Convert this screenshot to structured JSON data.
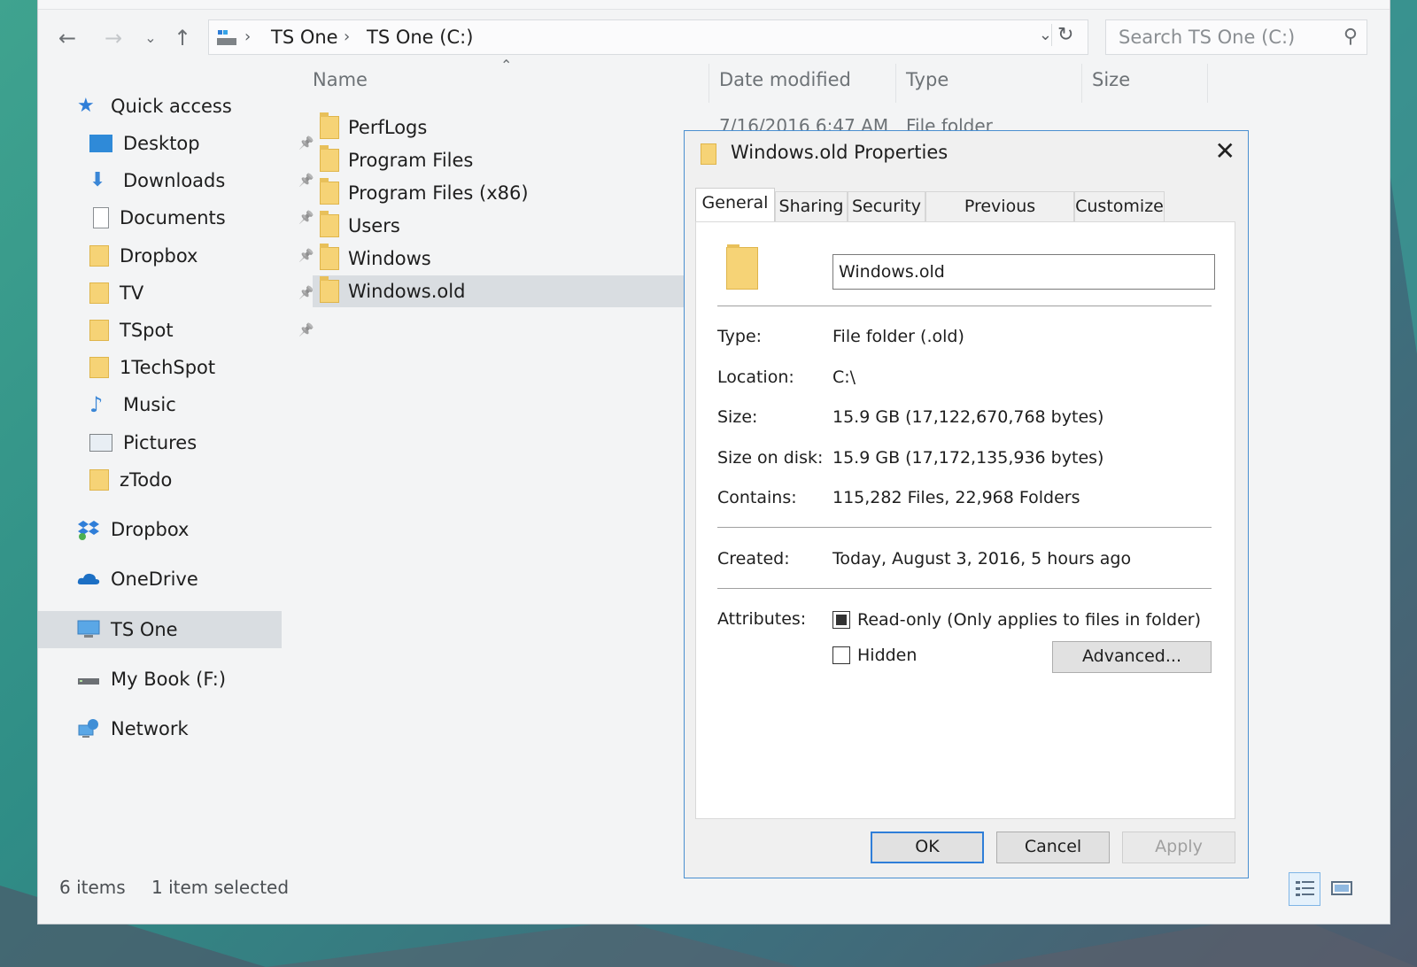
{
  "address": {
    "crumbs": [
      "TS One",
      "TS One (C:)"
    ],
    "search_placeholder": "Search TS One (C:)"
  },
  "columns": {
    "name": "Name",
    "date": "Date modified",
    "type": "Type",
    "size": "Size",
    "partial_date": "7/16/2016 6:47 AM",
    "partial_type": "File folder"
  },
  "nav": {
    "quick_access": "Quick access",
    "items": [
      {
        "label": "Desktop",
        "icon": "desktop-icon",
        "pinned": true
      },
      {
        "label": "Downloads",
        "icon": "downloads-icon",
        "pinned": true
      },
      {
        "label": "Documents",
        "icon": "documents-icon",
        "pinned": true
      },
      {
        "label": "Dropbox",
        "icon": "folder-icon",
        "pinned": true
      },
      {
        "label": "TV",
        "icon": "folder-icon",
        "pinned": true
      },
      {
        "label": "TSpot",
        "icon": "folder-icon",
        "pinned": true
      },
      {
        "label": "1TechSpot",
        "icon": "folder-icon",
        "pinned": false
      },
      {
        "label": "Music",
        "icon": "music-icon",
        "pinned": false
      },
      {
        "label": "Pictures",
        "icon": "pictures-icon",
        "pinned": false
      },
      {
        "label": "zTodo",
        "icon": "folder-icon",
        "pinned": false
      }
    ],
    "dropbox": "Dropbox",
    "onedrive": "OneDrive",
    "thispc": "TS One",
    "mybook": "My Book (F:)",
    "network": "Network"
  },
  "files": [
    {
      "name": "PerfLogs"
    },
    {
      "name": "Program Files"
    },
    {
      "name": "Program Files (x86)"
    },
    {
      "name": "Users"
    },
    {
      "name": "Windows"
    },
    {
      "name": "Windows.old",
      "selected": true
    }
  ],
  "status": {
    "items": "6 items",
    "selected": "1 item selected"
  },
  "dialog": {
    "title": "Windows.old Properties",
    "tabs": [
      "General",
      "Sharing",
      "Security",
      "Previous Versions",
      "Customize"
    ],
    "name_value": "Windows.old",
    "rows": {
      "type_label": "Type:",
      "type_value": "File folder (.old)",
      "location_label": "Location:",
      "location_value": "C:\\",
      "size_label": "Size:",
      "size_value": "15.9 GB (17,122,670,768 bytes)",
      "disk_label": "Size on disk:",
      "disk_value": "15.9 GB (17,172,135,936 bytes)",
      "contains_label": "Contains:",
      "contains_value": "115,282 Files, 22,968 Folders",
      "created_label": "Created:",
      "created_value": "Today, August 3, 2016, 5 hours ago",
      "attributes_label": "Attributes:"
    },
    "readonly_label": "Read-only (Only applies to files in folder)",
    "hidden_label": "Hidden",
    "advanced": "Advanced...",
    "ok": "OK",
    "cancel": "Cancel",
    "apply": "Apply"
  },
  "colors": {
    "accent": "#2f7ed8",
    "selection": "#d9dde1",
    "folder": "#f6d376"
  }
}
